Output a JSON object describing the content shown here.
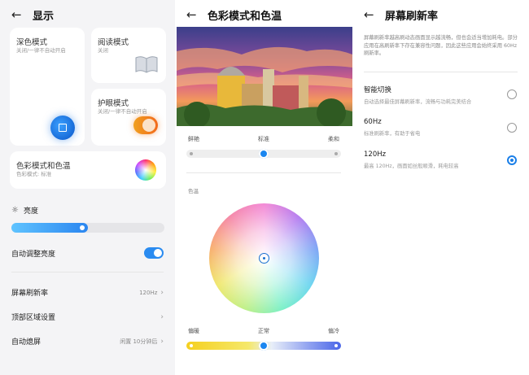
{
  "display": {
    "title": "显示",
    "dark_mode": {
      "title": "深色模式",
      "sub": "关闭/一律不自动开启"
    },
    "reading_mode": {
      "title": "阅读模式",
      "sub": "关闭"
    },
    "eye_care": {
      "title": "护眼模式",
      "sub": "关闭/一律不自动开启"
    },
    "color_mode": {
      "title": "色彩模式和色温",
      "sub": "色彩模式: 标准"
    },
    "brightness": {
      "label": "亮度",
      "level": 0.5
    },
    "auto_brightness": {
      "label": "自动调整亮度",
      "on": true
    },
    "refresh": {
      "label": "屏幕刷新率",
      "value": "120Hz"
    },
    "top_area": {
      "label": "顶部区域设置"
    },
    "screen_off": {
      "label": "自动熄屏",
      "value": "闲置 10分钟后"
    }
  },
  "color": {
    "title": "色彩模式和色温",
    "mode_labels": [
      "鲜艳",
      "标准",
      "柔和"
    ],
    "mode_selected": "标准",
    "temp_section": "色温",
    "temp_labels": [
      "偏暖",
      "正常",
      "偏冷"
    ],
    "temp_selected": "正常"
  },
  "refresh": {
    "title": "屏幕刷新率",
    "desc": "屏幕刷新率越高刷动态画面显示越流畅，但也会适当增加耗电。部分应用在高刷新率下存在兼容性问题，因此这些应用会始终采用 60Hz 刷新率。",
    "options": [
      {
        "title": "智能切换",
        "sub": "自动选择最佳屏幕刷新率，流畅与功耗完美结合",
        "selected": false
      },
      {
        "title": "60Hz",
        "sub": "标准刷新率，有助于省电",
        "selected": false
      },
      {
        "title": "120Hz",
        "sub": "最高 120Hz，画面如丝般顺滑，耗电较高",
        "selected": true
      }
    ]
  }
}
